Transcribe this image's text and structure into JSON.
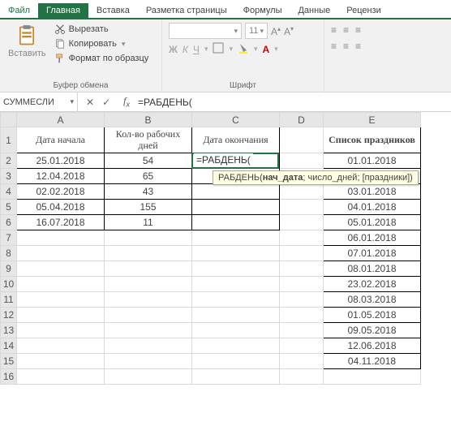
{
  "tabs": {
    "file": "Файл",
    "home": "Главная",
    "insert": "Вставка",
    "layout": "Разметка страницы",
    "formulas": "Формулы",
    "data": "Данные",
    "review": "Рецензи"
  },
  "ribbon": {
    "paste_label": "Вставить",
    "cut": "Вырезать",
    "copy": "Копировать",
    "format_painter": "Формат по образцу",
    "clipboard_group": "Буфер обмена",
    "font_group": "Шрифт",
    "font_size_value": "11",
    "bold": "Ж",
    "italic": "К",
    "underline": "Ч"
  },
  "namebox": "СУММЕСЛИ",
  "formula": "=РАБДЕНЬ(",
  "tooltip": {
    "fn": "РАБДЕНЬ",
    "arg1": "нач_дата",
    "arg2": "число_дней",
    "arg3": "[праздники]"
  },
  "col_headers": [
    "A",
    "B",
    "C",
    "D",
    "E"
  ],
  "row_headers": [
    "1",
    "2",
    "3",
    "4",
    "5",
    "6",
    "7",
    "8",
    "9",
    "10",
    "11",
    "12",
    "13",
    "14",
    "15",
    "16"
  ],
  "table": {
    "h_a": "Дата начала",
    "h_b": "Кол-во рабочих дней",
    "h_c": "Дата окончания",
    "h_e": "Список праздников",
    "rows": [
      {
        "a": "25.01.2018",
        "b": "54",
        "c": "=РАБДЕНЬ(",
        "e": "01.01.2018"
      },
      {
        "a": "12.04.2018",
        "b": "65",
        "c": "",
        "e": ""
      },
      {
        "a": "02.02.2018",
        "b": "43",
        "c": "",
        "e": "03.01.2018"
      },
      {
        "a": "05.04.2018",
        "b": "155",
        "c": "",
        "e": "04.01.2018"
      },
      {
        "a": "16.07.2018",
        "b": "11",
        "c": "",
        "e": "05.01.2018"
      }
    ],
    "extra_e": [
      "06.01.2018",
      "07.01.2018",
      "08.01.2018",
      "23.02.2018",
      "08.03.2018",
      "01.05.2018",
      "09.05.2018",
      "12.06.2018",
      "04.11.2018"
    ]
  }
}
